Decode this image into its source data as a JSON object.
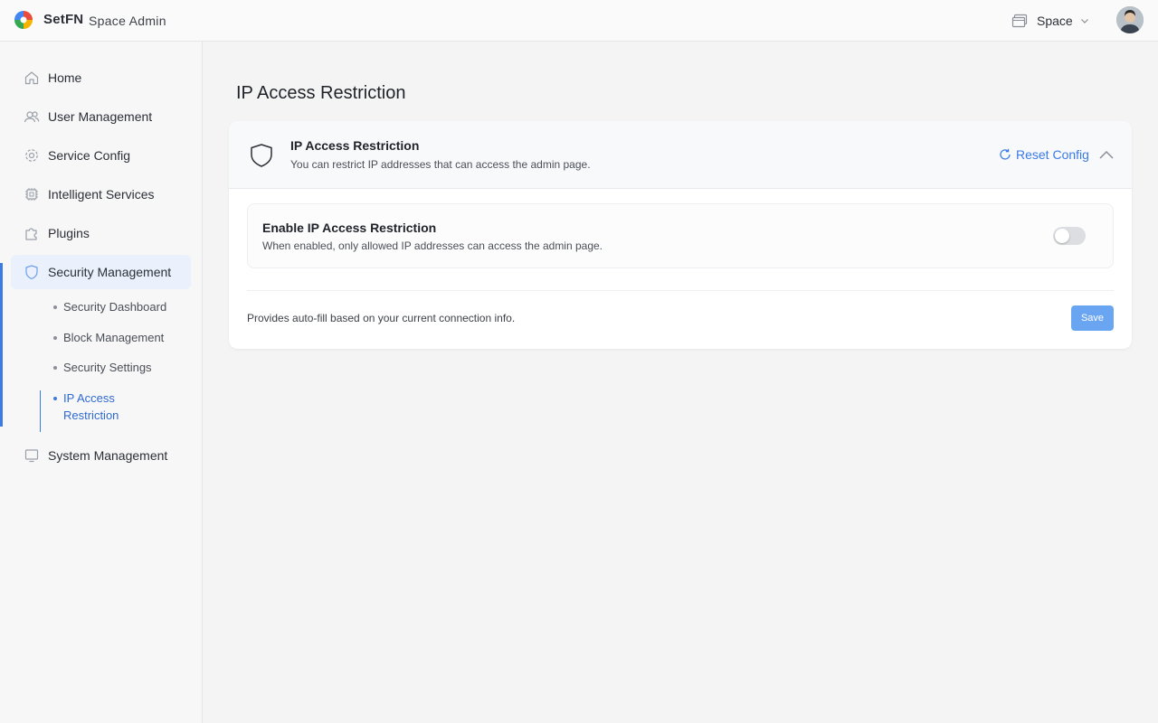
{
  "header": {
    "brand": "SetFN",
    "subtitle": "Space Admin",
    "space_label": "Space",
    "icons": {
      "logo": "colorful-pinwheel-logo",
      "space": "window-stack-icon",
      "dropdown": "chevron-down-icon",
      "avatar": "user-avatar"
    }
  },
  "sidebar": {
    "items": [
      {
        "label": "Home",
        "icon": "home-icon"
      },
      {
        "label": "User Management",
        "icon": "users-icon"
      },
      {
        "label": "Service Config",
        "icon": "gear-icon"
      },
      {
        "label": "Intelligent Services",
        "icon": "chip-icon"
      },
      {
        "label": "Plugins",
        "icon": "puzzle-icon"
      },
      {
        "label": "Security Management",
        "icon": "shield-icon",
        "active": true
      },
      {
        "label": "System Management",
        "icon": "monitor-icon"
      }
    ],
    "security_sub": [
      {
        "label": "Security Dashboard"
      },
      {
        "label": "Block Management"
      },
      {
        "label": "Security Settings"
      },
      {
        "label": "IP Access\nRestriction",
        "selected": true
      }
    ]
  },
  "main": {
    "page_title": "IP Access Restriction",
    "card": {
      "title": "IP Access Restriction",
      "description": "You can restrict IP addresses that can access the admin page.",
      "reset_label": "Reset Config",
      "toggle": {
        "title": "Enable IP Access Restriction",
        "description": "When enabled, only allowed IP addresses can access the admin page.",
        "enabled": false
      },
      "autofill_note": "Provides auto-fill based on your current connection info.",
      "save_label": "Save"
    }
  },
  "colors": {
    "accent": "#3a7be6",
    "save_button": "#6aa5f2",
    "active_nav_bg": "#eaf1fd",
    "switch_off": "#dcdee2"
  }
}
